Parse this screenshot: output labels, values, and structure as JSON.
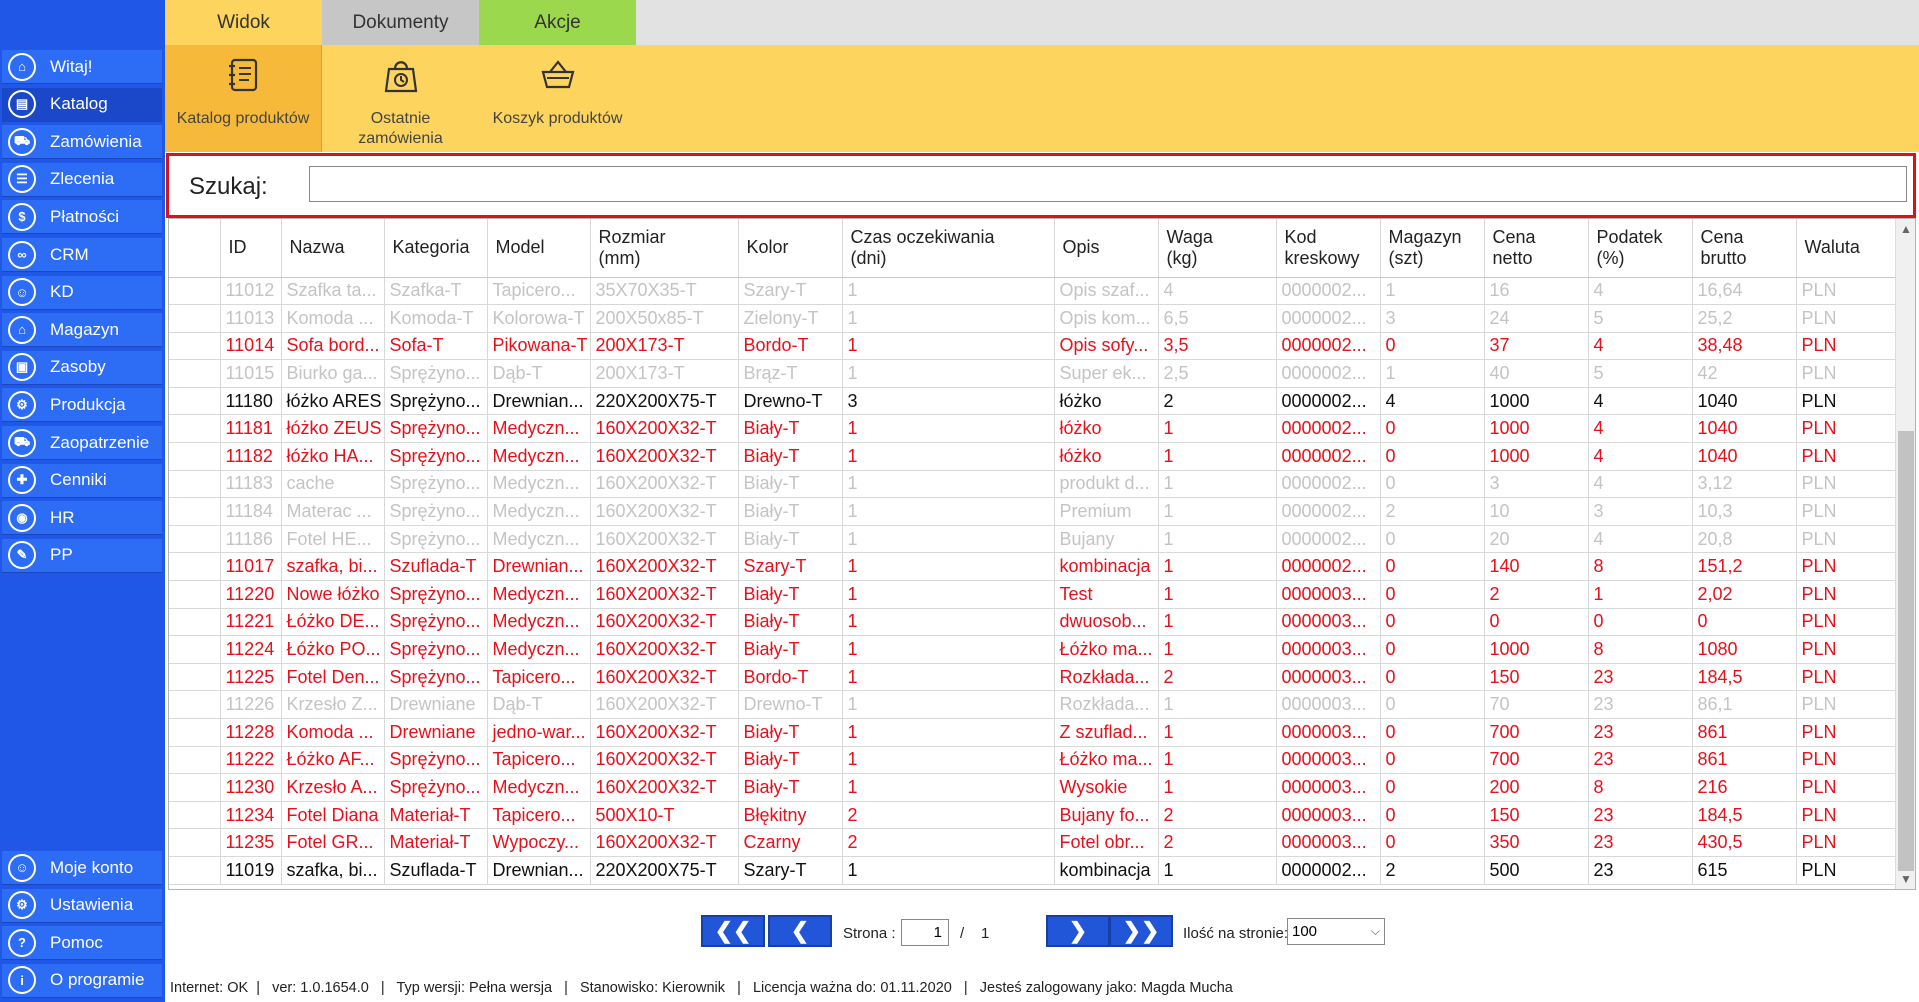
{
  "sidebar": {
    "items": [
      {
        "label": "Witaj!",
        "icon": "home-icon",
        "glyph": "⌂"
      },
      {
        "label": "Katalog",
        "icon": "catalog-book-icon",
        "glyph": "▤"
      },
      {
        "label": "Zamówienia",
        "icon": "cart-icon",
        "glyph": "⛟"
      },
      {
        "label": "Zlecenia",
        "icon": "list-icon",
        "glyph": "☰"
      },
      {
        "label": "Płatności",
        "icon": "dollar-icon",
        "glyph": "$"
      },
      {
        "label": "CRM",
        "icon": "crm-icon",
        "glyph": "∞"
      },
      {
        "label": "KD",
        "icon": "user-icon",
        "glyph": "☺"
      },
      {
        "label": "Magazyn",
        "icon": "warehouse-icon",
        "glyph": "⌂"
      },
      {
        "label": "Zasoby",
        "icon": "resources-icon",
        "glyph": "▣"
      },
      {
        "label": "Produkcja",
        "icon": "production-icon",
        "glyph": "⚙"
      },
      {
        "label": "Zaopatrzenie",
        "icon": "supply-icon",
        "glyph": "⛟"
      },
      {
        "label": "Cenniki",
        "icon": "price-tag-icon",
        "glyph": "✚"
      },
      {
        "label": "HR",
        "icon": "hr-icon",
        "glyph": "◉"
      },
      {
        "label": "PP",
        "icon": "pp-icon",
        "glyph": "✎"
      }
    ],
    "bottom": [
      {
        "label": "Moje konto",
        "icon": "account-icon",
        "glyph": "☺"
      },
      {
        "label": "Ustawienia",
        "icon": "settings-icon",
        "glyph": "⚙"
      },
      {
        "label": "Pomoc",
        "icon": "help-icon",
        "glyph": "?"
      },
      {
        "label": "O programie",
        "icon": "info-icon",
        "glyph": "i"
      }
    ]
  },
  "tabs": [
    {
      "label": "Widok",
      "color": "#fdd45e"
    },
    {
      "label": "Dokumenty",
      "color": "#c6c6c6"
    },
    {
      "label": "Akcje",
      "color": "#9bd84e"
    }
  ],
  "ribbon": {
    "catalog": "Katalog produktów",
    "recent_line1": "Ostatnie",
    "recent_line2": "zamówienia",
    "basket": "Koszyk produktów"
  },
  "search": {
    "label": "Szukaj:",
    "value": ""
  },
  "table": {
    "headers": [
      [
        "ID",
        ""
      ],
      [
        "Nazwa",
        ""
      ],
      [
        "Kategoria",
        ""
      ],
      [
        "Model",
        ""
      ],
      [
        "Rozmiar",
        "(mm)"
      ],
      [
        "Kolor",
        ""
      ],
      [
        "Czas oczekiwania",
        "(dni)"
      ],
      [
        "Opis",
        ""
      ],
      [
        "Waga",
        "(kg)"
      ],
      [
        "Kod",
        "kreskowy"
      ],
      [
        "Magazyn",
        "(szt)"
      ],
      [
        "Cena",
        "netto"
      ],
      [
        "Podatek",
        "(%)"
      ],
      [
        "Cena",
        "brutto"
      ],
      [
        "Waluta",
        ""
      ]
    ],
    "rows": [
      {
        "s": "inactive",
        "c": [
          "11012",
          "Szafka ta...",
          "Szafka-T",
          "Tapicero...",
          "35X70X35-T",
          "Szary-T",
          "1",
          "Opis szaf...",
          "4",
          "0000002...",
          "1",
          "16",
          "4",
          "16,64",
          "PLN"
        ]
      },
      {
        "s": "inactive",
        "c": [
          "11013",
          "Komoda ...",
          "Komoda-T",
          "Kolorowa-T",
          "200X50x85-T",
          "Zielony-T",
          "1",
          "Opis kom...",
          "6,5",
          "0000002...",
          "3",
          "24",
          "5",
          "25,2",
          "PLN"
        ]
      },
      {
        "s": "warn",
        "c": [
          "11014",
          "Sofa bord...",
          "Sofa-T",
          "Pikowana-T",
          "200X173-T",
          "Bordo-T",
          "1",
          "Opis sofy...",
          "3,5",
          "0000002...",
          "0",
          "37",
          "4",
          "38,48",
          "PLN"
        ]
      },
      {
        "s": "inactive",
        "c": [
          "11015",
          "Biurko ga...",
          "Sprężyno...",
          "Dąb-T",
          "200X173-T",
          "Brąz-T",
          "1",
          "Super ek...",
          "2,5",
          "0000002...",
          "1",
          "40",
          "5",
          "42",
          "PLN"
        ]
      },
      {
        "s": "normal",
        "c": [
          "11180",
          "łóżko ARES",
          "Sprężyno...",
          "Drewnian...",
          "220X200X75-T",
          "Drewno-T",
          "3",
          "łóżko",
          "2",
          "0000002...",
          "4",
          "1000",
          "4",
          "1040",
          "PLN"
        ]
      },
      {
        "s": "warn",
        "c": [
          "11181",
          "łóżko ZEUS",
          "Sprężyno...",
          "Medyczn...",
          "160X200X32-T",
          "Biały-T",
          "1",
          "łóżko",
          "1",
          "0000002...",
          "0",
          "1000",
          "4",
          "1040",
          "PLN"
        ]
      },
      {
        "s": "warn",
        "c": [
          "11182",
          "łóżko HA...",
          "Sprężyno...",
          "Medyczn...",
          "160X200X32-T",
          "Biały-T",
          "1",
          "łóżko",
          "1",
          "0000002...",
          "0",
          "1000",
          "4",
          "1040",
          "PLN"
        ]
      },
      {
        "s": "inactive",
        "c": [
          "11183",
          "cache",
          "Sprężyno...",
          "Medyczn...",
          "160X200X32-T",
          "Biały-T",
          "1",
          "produkt d...",
          "1",
          "0000002...",
          "0",
          "3",
          "4",
          "3,12",
          "PLN"
        ]
      },
      {
        "s": "inactive",
        "c": [
          "11184",
          "Materac ...",
          "Sprężyno...",
          "Medyczn...",
          "160X200X32-T",
          "Biały-T",
          "1",
          "Premium",
          "1",
          "0000002...",
          "2",
          "10",
          "3",
          "10,3",
          "PLN"
        ]
      },
      {
        "s": "inactive",
        "c": [
          "11186",
          "Fotel HE...",
          "Sprężyno...",
          "Medyczn...",
          "160X200X32-T",
          "Biały-T",
          "1",
          "Bujany",
          "1",
          "0000002...",
          "0",
          "20",
          "4",
          "20,8",
          "PLN"
        ]
      },
      {
        "s": "warn",
        "c": [
          "11017",
          "szafka, bi...",
          "Szuflada-T",
          "Drewnian...",
          "160X200X32-T",
          "Szary-T",
          "1",
          "kombinacja",
          "1",
          "0000002...",
          "0",
          "140",
          "8",
          "151,2",
          "PLN"
        ]
      },
      {
        "s": "warn",
        "c": [
          "11220",
          "Nowe łóżko",
          "Sprężyno...",
          "Medyczn...",
          "160X200X32-T",
          "Biały-T",
          "1",
          "Test",
          "1",
          "0000003...",
          "0",
          "2",
          "1",
          "2,02",
          "PLN"
        ]
      },
      {
        "s": "warn",
        "c": [
          "11221",
          "Łóżko DE...",
          "Sprężyno...",
          "Medyczn...",
          "160X200X32-T",
          "Biały-T",
          "1",
          "dwuosob...",
          "1",
          "0000003...",
          "0",
          "0",
          "0",
          "0",
          "PLN"
        ]
      },
      {
        "s": "warn",
        "c": [
          "11224",
          "Łóżko PO...",
          "Sprężyno...",
          "Medyczn...",
          "160X200X32-T",
          "Biały-T",
          "1",
          "Łóżko ma...",
          "1",
          "0000003...",
          "0",
          "1000",
          "8",
          "1080",
          "PLN"
        ]
      },
      {
        "s": "warn",
        "c": [
          "11225",
          "Fotel Den...",
          "Sprężyno...",
          "Tapicero...",
          "160X200X32-T",
          "Bordo-T",
          "1",
          "Rozkłada...",
          "2",
          "0000003...",
          "0",
          "150",
          "23",
          "184,5",
          "PLN"
        ]
      },
      {
        "s": "inactive",
        "c": [
          "11226",
          "Krzesło Z...",
          "Drewniane",
          "Dąb-T",
          "160X200X32-T",
          "Drewno-T",
          "1",
          "Rozkłada...",
          "1",
          "0000003...",
          "0",
          "70",
          "23",
          "86,1",
          "PLN"
        ]
      },
      {
        "s": "warn",
        "c": [
          "11228",
          "Komoda ...",
          "Drewniane",
          "jedno-war...",
          "160X200X32-T",
          "Biały-T",
          "1",
          "Z szuflad...",
          "1",
          "0000003...",
          "0",
          "700",
          "23",
          "861",
          "PLN"
        ]
      },
      {
        "s": "warn",
        "c": [
          "11222",
          "Łóżko AF...",
          "Sprężyno...",
          "Tapicero...",
          "160X200X32-T",
          "Biały-T",
          "1",
          "Łóżko ma...",
          "1",
          "0000003...",
          "0",
          "700",
          "23",
          "861",
          "PLN"
        ]
      },
      {
        "s": "warn",
        "c": [
          "11230",
          "Krzesło A...",
          "Sprężyno...",
          "Medyczn...",
          "160X200X32-T",
          "Biały-T",
          "1",
          "Wysokie",
          "1",
          "0000003...",
          "0",
          "200",
          "8",
          "216",
          "PLN"
        ]
      },
      {
        "s": "warn",
        "c": [
          "11234",
          "Fotel Diana",
          "Materiał-T",
          "Tapicero...",
          "500X10-T",
          "Błękitny",
          "2",
          "Bujany fo...",
          "2",
          "0000003...",
          "0",
          "150",
          "23",
          "184,5",
          "PLN"
        ]
      },
      {
        "s": "warn",
        "c": [
          "11235",
          "Fotel GR...",
          "Materiał-T",
          "Wypoczy...",
          "160X200X32-T",
          "Czarny",
          "2",
          "Fotel obr...",
          "2",
          "0000003...",
          "0",
          "350",
          "23",
          "430,5",
          "PLN"
        ]
      },
      {
        "s": "normal",
        "c": [
          "11019",
          "szafka, bi...",
          "Szuflada-T",
          "Drewnian...",
          "220X200X75-T",
          "Szary-T",
          "1",
          "kombinacja",
          "1",
          "0000002...",
          "2",
          "500",
          "23",
          "615",
          "PLN"
        ]
      }
    ]
  },
  "pager": {
    "first": "❮❮",
    "prev": "❮",
    "next": "❯",
    "last": "❯❯",
    "page_label": "Strona :",
    "page": "1",
    "sep": "/",
    "total": "1",
    "per_page_label": "Ilość na stronie:",
    "per_page": "100"
  },
  "status": "Internet: OK  |   ver: 1.0.1654.0   |   Typ wersji: Pełna wersja   |   Stanowisko: Kierownik   |   Licencja ważna do: 01.11.2020   |   Jesteś zalogowany jako: Magda Mucha"
}
